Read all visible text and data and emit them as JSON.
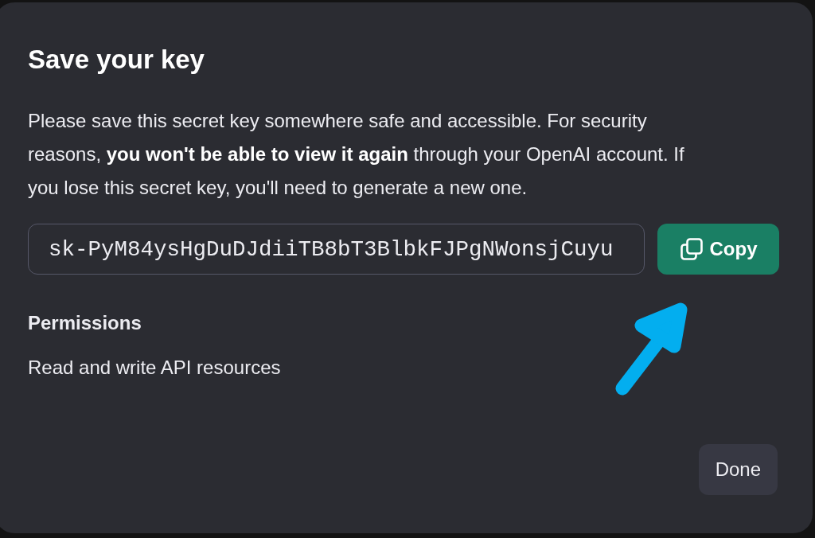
{
  "dialog": {
    "title": "Save your key",
    "message": "Please save this secret key somewhere safe and accessible. For security reasons, **you won't be able to view it again** through your OpenAI account. If you lose this secret key, you'll need to generate a new one.",
    "key_field": {
      "value": "sk-PyM84ysHgDuDJdiiTB8bT3BlbkFJPgNWonsjCuyu"
    },
    "copy_button": {
      "label": "Copy"
    },
    "permissions": {
      "heading": "Permissions",
      "value": "Read and write API resources"
    },
    "buttons": [
      {
        "label": "Done"
      }
    ]
  }
}
